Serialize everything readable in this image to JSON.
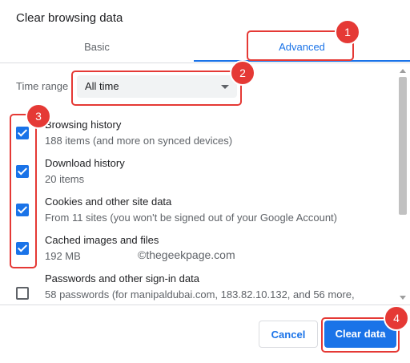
{
  "dialog": {
    "title": "Clear browsing data",
    "tabs": [
      {
        "label": "Basic"
      },
      {
        "label": "Advanced"
      }
    ],
    "time_range": {
      "label": "Time range",
      "value": "All time"
    },
    "items": [
      {
        "title": "Browsing history",
        "desc": "188 items (and more on synced devices)",
        "checked": true
      },
      {
        "title": "Download history",
        "desc": "20 items",
        "checked": true
      },
      {
        "title": "Cookies and other site data",
        "desc": "From 11 sites (you won't be signed out of your Google Account)",
        "checked": true
      },
      {
        "title": "Cached images and files",
        "desc": "192 MB",
        "checked": true
      },
      {
        "title": "Passwords and other sign-in data",
        "desc": "58 passwords (for manipaldubai.com, 183.82.10.132, and 56 more,",
        "checked": false
      }
    ],
    "buttons": {
      "cancel": "Cancel",
      "clear": "Clear data"
    }
  },
  "watermark": "©thegeekpage.com",
  "annotations": {
    "badges": [
      "1",
      "2",
      "3",
      "4"
    ],
    "color": "#e53935"
  },
  "colors": {
    "accent": "#1a73e8"
  }
}
